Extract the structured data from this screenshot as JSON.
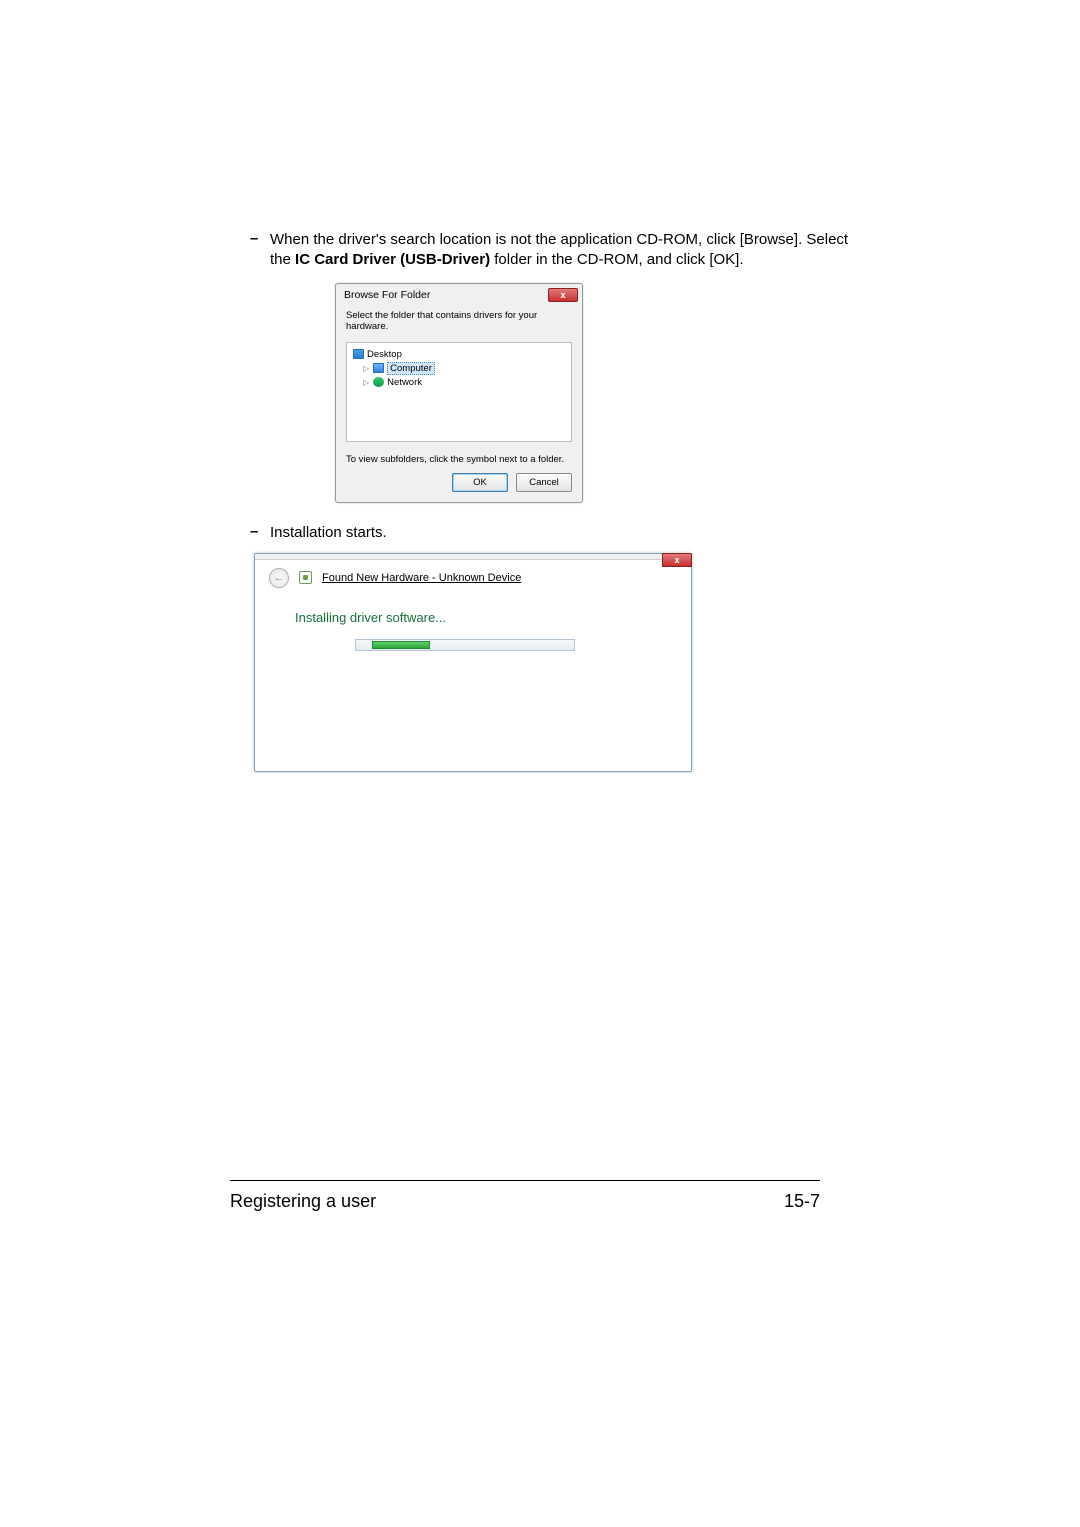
{
  "bullets": {
    "b1_pre": "When the driver's search location is not the application CD-ROM, click [Browse]. Select the ",
    "b1_bold": "IC Card Driver (USB-Driver)",
    "b1_post": " folder in the CD-ROM, and click [OK].",
    "b2": "Installation starts."
  },
  "browse": {
    "title": "Browse For Folder",
    "subtitle": "Select the folder that contains drivers for your hardware.",
    "tree": {
      "desktop": "Desktop",
      "computer": "Computer",
      "network": "Network"
    },
    "hint": "To view subfolders, click the symbol next to a folder.",
    "ok": "OK",
    "cancel": "Cancel",
    "close_glyph": "x"
  },
  "wizard": {
    "title": "Found New Hardware - Unknown Device",
    "status": "Installing driver software...",
    "back_glyph": "←",
    "close_glyph": "x"
  },
  "footer": {
    "section": "Registering a user",
    "page": "15-7"
  }
}
